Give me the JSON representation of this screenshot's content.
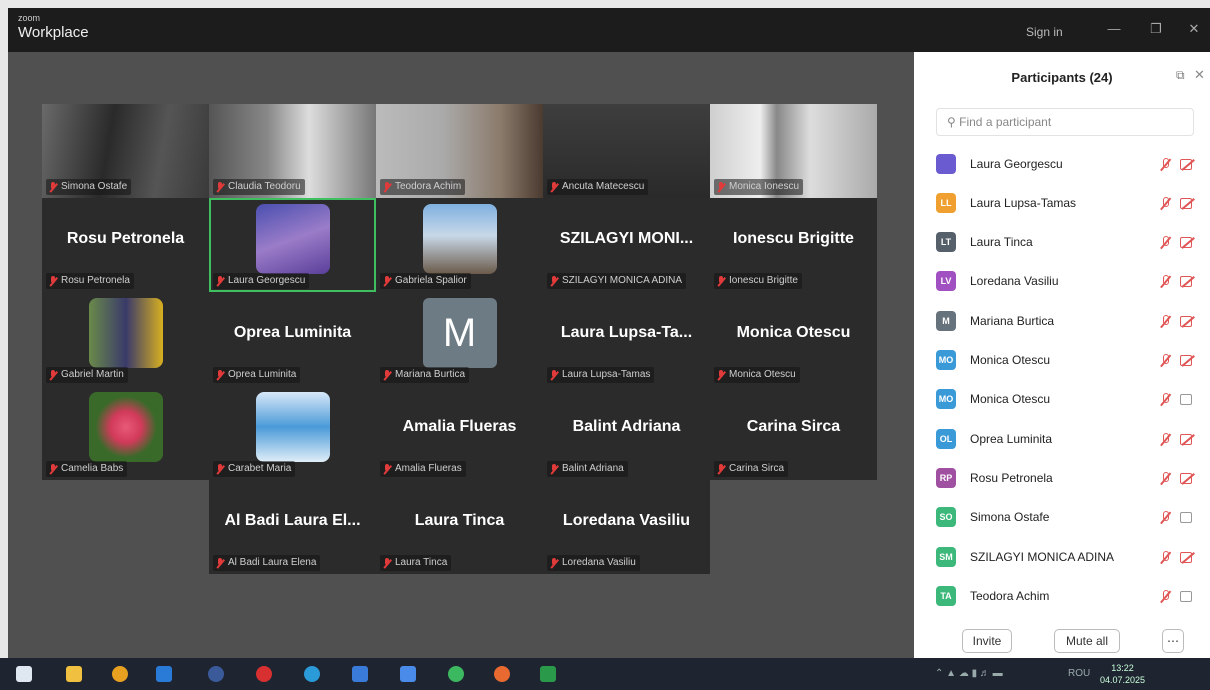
{
  "window": {
    "brand_small": "zoom",
    "brand_big": "Workplace",
    "sign_in": "Sign in"
  },
  "gallery": {
    "tiles": [
      {
        "name": "Simona Ostafe",
        "style": "video",
        "big": ""
      },
      {
        "name": "Claudia Teodoru",
        "style": "video",
        "big": ""
      },
      {
        "name": "Teodora Achim",
        "style": "video",
        "big": ""
      },
      {
        "name": "Ancuta Matecescu",
        "style": "video",
        "big": ""
      },
      {
        "name": "Monica Ionescu",
        "style": "video",
        "big": ""
      },
      {
        "name": "Rosu Petronela",
        "style": "text",
        "big": "Rosu Petronela"
      },
      {
        "name": "Laura Georgescu",
        "style": "avatar",
        "big": ""
      },
      {
        "name": "Gabriela Spalior",
        "style": "avatar",
        "big": ""
      },
      {
        "name": "SZILAGYI MONICA ADINA",
        "style": "text",
        "big": "SZILAGYI  MONI..."
      },
      {
        "name": "Ionescu Brigitte",
        "style": "text",
        "big": "Ionescu Brigitte"
      },
      {
        "name": "Gabriel Martin",
        "style": "avatar",
        "big": ""
      },
      {
        "name": "Oprea Luminita",
        "style": "text",
        "big": "Oprea Luminita"
      },
      {
        "name": "Mariana Burtica",
        "style": "letter",
        "big": "M"
      },
      {
        "name": "Laura Lupsa-Tamas",
        "style": "text",
        "big": "Laura  Lupsa-Ta..."
      },
      {
        "name": "Monica Otescu",
        "style": "text",
        "big": "Monica Otescu"
      },
      {
        "name": "Camelia Babs",
        "style": "avatar",
        "big": ""
      },
      {
        "name": "Carabet Maria",
        "style": "avatar",
        "big": ""
      },
      {
        "name": "Amalia Flueras",
        "style": "text",
        "big": "Amalia Flueras"
      },
      {
        "name": "Balint Adriana",
        "style": "text",
        "big": "Balint Adriana"
      },
      {
        "name": "Carina Sirca",
        "style": "text",
        "big": "Carina Sirca"
      },
      {
        "name": "Al Badi Laura Elena",
        "style": "text",
        "big": "Al Badi  Laura El..."
      },
      {
        "name": "Laura Tinca",
        "style": "text",
        "big": "Laura Tinca"
      },
      {
        "name": "Loredana Vasiliu",
        "style": "text",
        "big": "Loredana Vasiliu"
      }
    ]
  },
  "participants": {
    "title": "Participants (24)",
    "search_placeholder": "Find a participant",
    "list": [
      {
        "initials": "",
        "name": "Laura Georgescu",
        "color": "#6a5bd0",
        "camera": "off"
      },
      {
        "initials": "LL",
        "name": "Laura Lupsa-Tamas",
        "color": "#f0a030",
        "camera": "off"
      },
      {
        "initials": "LT",
        "name": "Laura Tinca",
        "color": "#55606a",
        "camera": "off"
      },
      {
        "initials": "LV",
        "name": "Loredana Vasiliu",
        "color": "#a050c0",
        "camera": "off"
      },
      {
        "initials": "M",
        "name": "Mariana Burtica",
        "color": "#66727c",
        "camera": "off"
      },
      {
        "initials": "MO",
        "name": "Monica Otescu",
        "color": "#3a9ad8",
        "camera": "off"
      },
      {
        "initials": "MO",
        "name": "Monica Otescu",
        "color": "#3a9ad8",
        "camera": "on"
      },
      {
        "initials": "OL",
        "name": "Oprea Luminita",
        "color": "#3a9ad8",
        "camera": "off"
      },
      {
        "initials": "RP",
        "name": "Rosu Petronela",
        "color": "#a050a0",
        "camera": "off"
      },
      {
        "initials": "SO",
        "name": "Simona Ostafe",
        "color": "#3cb87a",
        "camera": "on"
      },
      {
        "initials": "SM",
        "name": "SZILAGYI MONICA ADINA",
        "color": "#3cb87a",
        "camera": "off"
      },
      {
        "initials": "TA",
        "name": "Teodora Achim",
        "color": "#3cb87a",
        "camera": "on"
      }
    ],
    "invite_label": "Invite",
    "mute_all_label": "Mute all",
    "more_label": "⋯"
  },
  "taskbar": {
    "lang": "ROU",
    "time": "13:22",
    "date": "04.07.2025",
    "apps": [
      "windows-icon",
      "file-explorer-icon",
      "chrome-icon",
      "outlook-icon",
      "cortana-icon",
      "opera-icon",
      "edge-icon",
      "store-icon",
      "zoom-icon",
      "whatsapp-icon",
      "chrome-profile-icon",
      "excel-icon"
    ]
  }
}
